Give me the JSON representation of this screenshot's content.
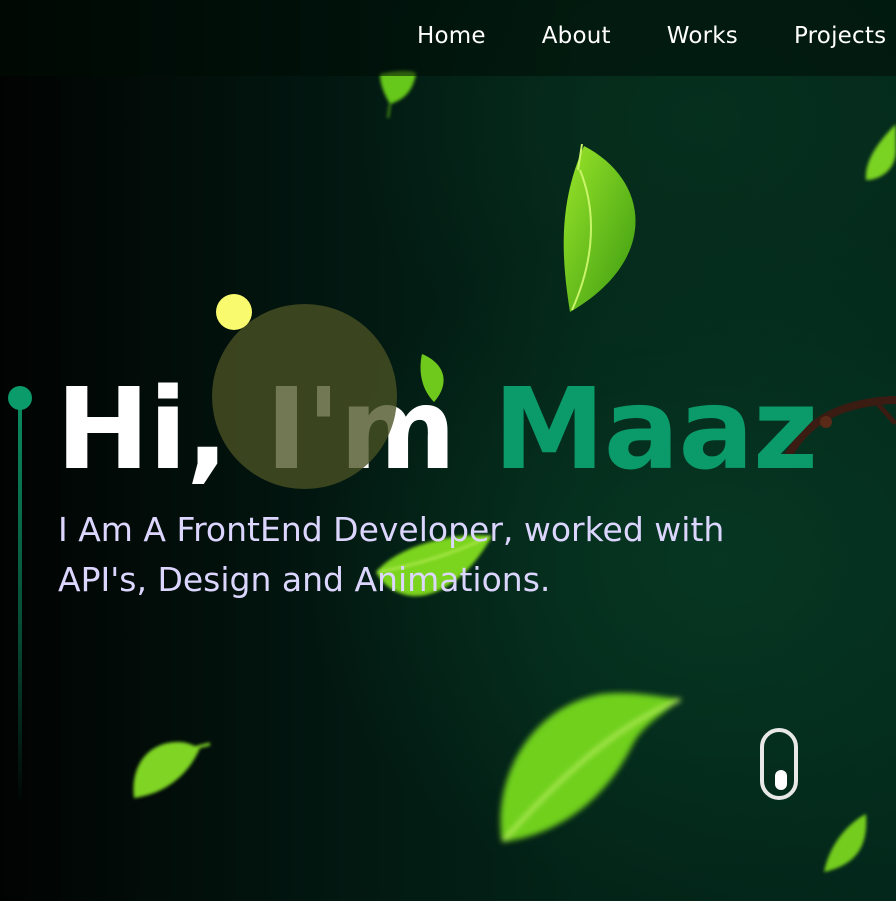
{
  "nav": {
    "items": [
      {
        "label": "Home"
      },
      {
        "label": "About"
      },
      {
        "label": "Works"
      },
      {
        "label": "Projects"
      }
    ]
  },
  "hero": {
    "greeting": "Hi, I'm",
    "name": "Maaz",
    "subtitle": "I Am A FrontEnd Developer, worked with API's, Design and Animations."
  },
  "colors": {
    "accent": "#0b9a6a",
    "subtitle": "#dcd6ff",
    "highlight_dot": "#fafa6e",
    "leaf_green": "#6fd21c"
  },
  "icons": [
    "mouse-scroll-icon",
    "leaf-icon",
    "branch-icon"
  ]
}
